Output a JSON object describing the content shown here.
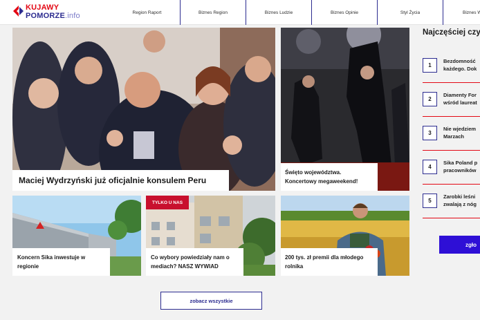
{
  "header": {
    "logo_line1": "KUJAWY",
    "logo_line2": "POMORZE",
    "logo_suffix": ".info",
    "nav": [
      "Region Raport",
      "Biznes Region",
      "Biznes Ludzie",
      "Biznes Opinie",
      "Styl Życia",
      "Biznes Wspar"
    ]
  },
  "articles": {
    "main": {
      "title": "Maciej Wydrzyński już oficjalnie konsulem Peru"
    },
    "concert": {
      "title_line1": "Święto województwa.",
      "title_line2": "Koncertowy megaweekend!"
    },
    "sika": {
      "title_line1": "Koncern Sika inwestuje w",
      "title_line2": "regionie"
    },
    "wybory": {
      "badge": "TYLKO U NAS",
      "title_line1": "Co wybory powiedziały nam o",
      "title_line2": "mediach? NASZ WYWIAD"
    },
    "premia": {
      "title_line1": "200 tys. zł premii dla młodego",
      "title_line2": "rolnika"
    }
  },
  "sidebar": {
    "title": "Najczęściej czy",
    "items": [
      {
        "num": "1",
        "line1": "Bezdomność",
        "line2": "każdego. Dok"
      },
      {
        "num": "2",
        "line1": "Diamenty For",
        "line2": "wśród laureat"
      },
      {
        "num": "3",
        "line1": "Nie wjedziem",
        "line2": "Marzach"
      },
      {
        "num": "4",
        "line1": "Sika Poland p",
        "line2": "pracowników"
      },
      {
        "num": "5",
        "line1": "Zarobki leśni",
        "line2": "zwalają z nóg"
      }
    ],
    "button": "zgło"
  },
  "more_button": "zobacz wszystkie",
  "colors": {
    "brand_red": "#e30613",
    "brand_navy": "#2b2b8f",
    "button_blue": "#2e0fd6"
  }
}
